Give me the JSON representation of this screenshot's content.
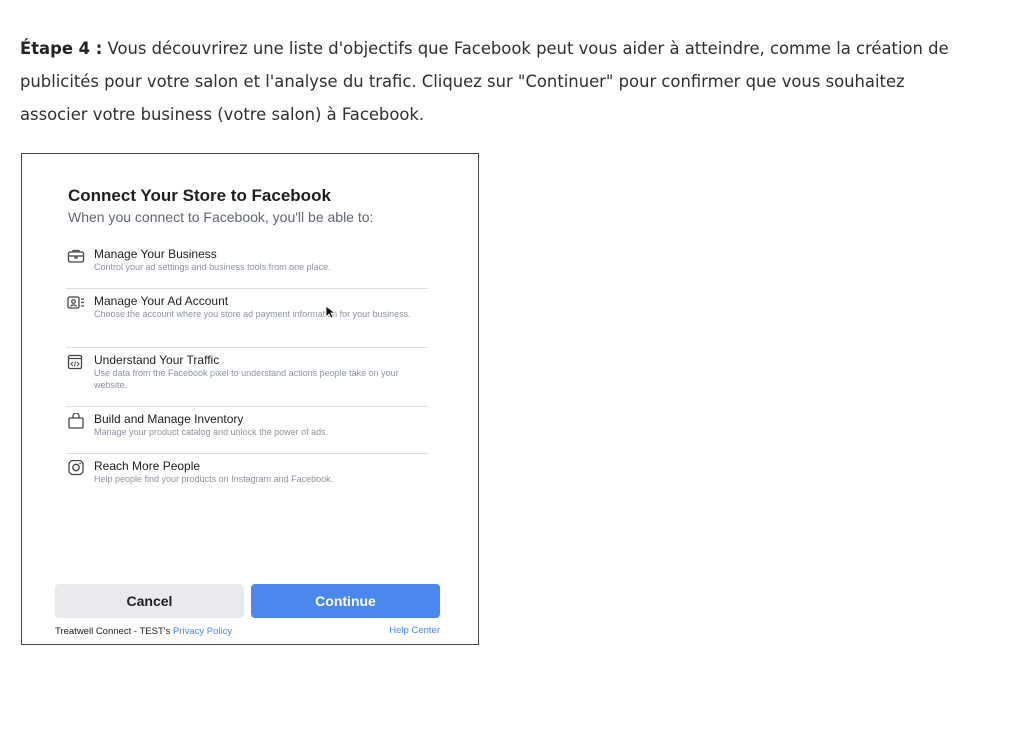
{
  "intro": {
    "step_label": "Étape 4 :",
    "text": " Vous découvrirez une liste d'objectifs que Facebook peut vous aider à atteindre, comme la création de publicités pour votre salon et l'analyse du trafic. Cliquez sur \"Continuer\" pour confirmer que vous souhaitez associer votre business (votre salon) à Facebook."
  },
  "dialog": {
    "title": "Connect Your Store to Facebook",
    "subtitle": "When you connect to Facebook, you'll be able to:",
    "items": [
      {
        "icon": "briefcase-icon",
        "title": "Manage Your Business",
        "desc": "Control your ad settings and business tools from one place."
      },
      {
        "icon": "ad-account-icon",
        "title": "Manage Your Ad Account",
        "desc": "Choose the account where you store ad payment information for your business."
      },
      {
        "icon": "code-icon",
        "title": "Understand Your Traffic",
        "desc": "Use data from the Facebook pixel to understand actions people take on your website."
      },
      {
        "icon": "shopping-bag-icon",
        "title": "Build and Manage Inventory",
        "desc": "Manage your product catalog and unlock the power of ads."
      },
      {
        "icon": "instagram-icon",
        "title": "Reach More People",
        "desc": "Help people find your products on Instagram and Facebook."
      }
    ],
    "cancel_label": "Cancel",
    "continue_label": "Continue",
    "footer_prefix": "Treatwell Connect - TEST's ",
    "privacy_label": "Privacy Policy",
    "help_label": "Help Center"
  },
  "colors": {
    "accent": "#4a88f0",
    "cancel_bg": "#e9eaed"
  }
}
